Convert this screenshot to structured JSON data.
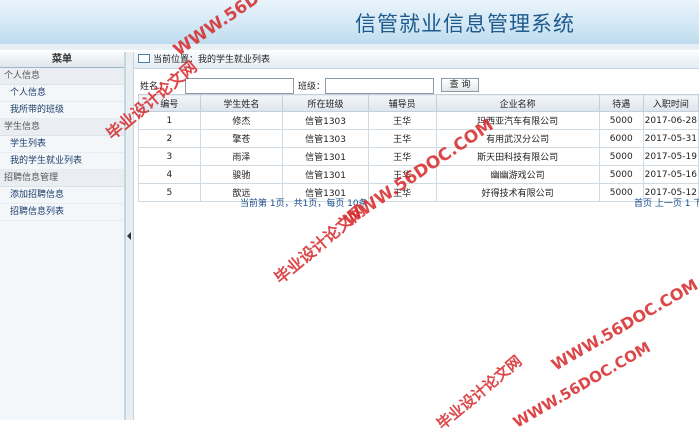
{
  "app": {
    "title": "信管就业信息管理系统"
  },
  "sidebar": {
    "menu_title": "菜单",
    "groups": [
      {
        "label": "个人信息",
        "items": [
          {
            "label": "个人信息"
          },
          {
            "label": "我所带的班级"
          }
        ]
      },
      {
        "label": "学生信息",
        "items": [
          {
            "label": "学生列表"
          },
          {
            "label": "我的学生就业列表"
          }
        ]
      },
      {
        "label": "招聘信息管理",
        "items": [
          {
            "label": "添加招聘信息"
          },
          {
            "label": "招聘信息列表"
          }
        ]
      }
    ]
  },
  "breadcrumb": {
    "text": "当前位置：我的学生就业列表"
  },
  "search": {
    "name_label": "姓名：",
    "class_label": "班级：",
    "name_value": "",
    "class_value": "",
    "button_label": "查 询"
  },
  "table": {
    "headers": [
      "编号",
      "学生姓名",
      "所在班级",
      "辅导员",
      "企业名称",
      "待遇",
      "入职时间"
    ],
    "rows": [
      [
        "1",
        "修杰",
        "信管1303",
        "王华",
        "玛西亚汽车有限公司",
        "5000",
        "2017-06-28"
      ],
      [
        "2",
        "擎苍",
        "信管1303",
        "王华",
        "有用武汉分公司",
        "6000",
        "2017-05-31"
      ],
      [
        "3",
        "雨泽",
        "信管1301",
        "王华",
        "斯天田科技有限公司",
        "5000",
        "2017-05-19"
      ],
      [
        "4",
        "骏驰",
        "信管1301",
        "王华",
        "幽幽游戏公司",
        "5000",
        "2017-05-16"
      ],
      [
        "5",
        "歆远",
        "信管1301",
        "王华",
        "好得技术有限公司",
        "5000",
        "2017-05-12"
      ]
    ]
  },
  "pager": {
    "summary": "当前第 1页，共1页，每页 10条",
    "links": [
      "首页",
      "上一页",
      "1",
      "下"
    ]
  },
  "watermarks": [
    "WWW.56DOC.COM",
    "毕业设计论文网",
    "WWW.56DOC.COM",
    "毕业设计论文网",
    "WWW.56DOC.COM",
    "毕业设计论文网",
    "WWW.56DOC.COM"
  ]
}
